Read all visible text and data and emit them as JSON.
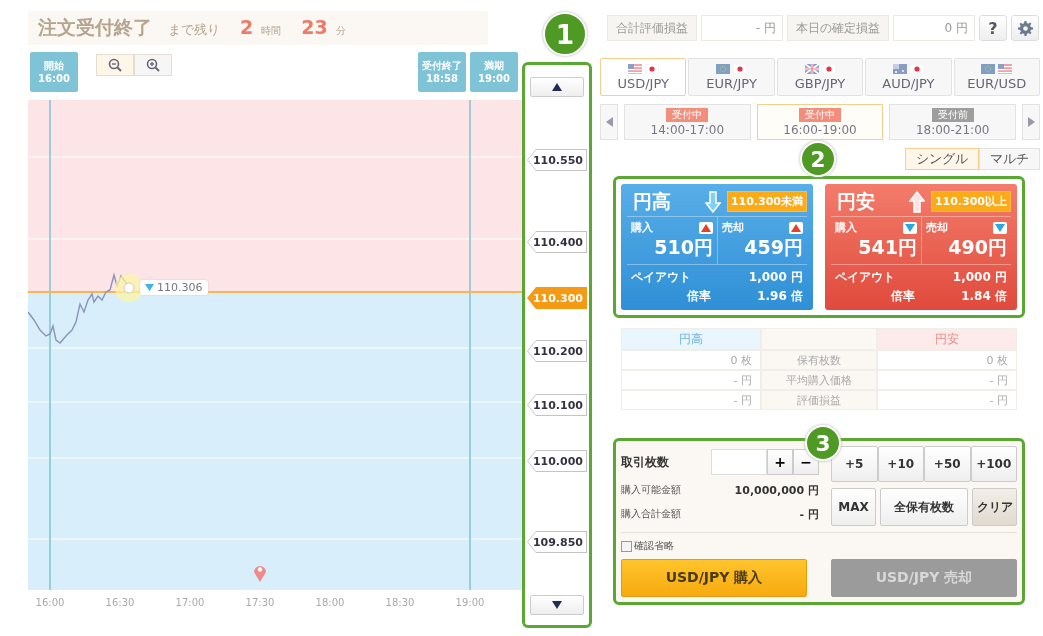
{
  "header": {
    "title": "注文受付終了",
    "remaining_label": "まで残り",
    "hours": "2",
    "hours_unit": "時間",
    "minutes": "23",
    "minutes_unit": "分",
    "summary": [
      {
        "label": "合計評価損益",
        "value": "- 円"
      },
      {
        "label": "本日の確定損益",
        "value": "0 円"
      }
    ],
    "help_button": "?"
  },
  "chart": {
    "markers": [
      {
        "label": "開始",
        "time": "16:00"
      },
      {
        "label": "受付終了",
        "time": "18:58"
      },
      {
        "label": "満期",
        "time": "19:00"
      }
    ],
    "current_price": "110.306",
    "x_labels": [
      "16:00",
      "16:30",
      "17:00",
      "17:30",
      "18:00",
      "18:30",
      "19:00"
    ]
  },
  "ladder": [
    {
      "label": "110.550",
      "selected": false
    },
    {
      "label": "110.400",
      "selected": false
    },
    {
      "label": "110.300",
      "selected": true
    },
    {
      "label": "110.200",
      "selected": false
    },
    {
      "label": "110.100",
      "selected": false
    },
    {
      "label": "110.000",
      "selected": false
    },
    {
      "label": "109.850",
      "selected": false
    }
  ],
  "currency_tabs": [
    {
      "label": "USD/JPY",
      "selected": true
    },
    {
      "label": "EUR/JPY",
      "selected": false
    },
    {
      "label": "GBP/JPY",
      "selected": false
    },
    {
      "label": "AUD/JPY",
      "selected": false
    },
    {
      "label": "EUR/USD",
      "selected": false
    }
  ],
  "sessions": [
    {
      "status": "受付中",
      "accepting": true,
      "time": "14:00-17:00",
      "selected": false
    },
    {
      "status": "受付中",
      "accepting": true,
      "time": "16:00-19:00",
      "selected": true
    },
    {
      "status": "受付前",
      "accepting": false,
      "time": "18:00-21:00",
      "selected": false
    }
  ],
  "modes": [
    {
      "label": "シングル",
      "selected": true
    },
    {
      "label": "マルチ",
      "selected": false
    }
  ],
  "options": [
    {
      "kind": "high",
      "title": "円高",
      "condition": "110.300未満",
      "buy_label": "購入",
      "buy_price": "510円",
      "buy_rising": true,
      "sell_label": "売却",
      "sell_price": "459円",
      "sell_rising": true,
      "payout_label": "ペイアウト",
      "payout": "1,000 円",
      "rate_label": "倍率",
      "rate": "1.96 倍"
    },
    {
      "kind": "low",
      "title": "円安",
      "condition": "110.300以上",
      "buy_label": "購入",
      "buy_price": "541円",
      "buy_rising": false,
      "sell_label": "売却",
      "sell_price": "490円",
      "sell_rising": false,
      "payout_label": "ペイアウト",
      "payout": "1,000 円",
      "rate_label": "倍率",
      "rate": "1.84 倍"
    }
  ],
  "positions": {
    "high_header": "円高",
    "low_header": "円安",
    "rows": [
      {
        "label": "保有枚数",
        "high": "0 枚",
        "low": "0 枚"
      },
      {
        "label": "平均購入価格",
        "high": "- 円",
        "low": "- 円"
      },
      {
        "label": "評価損益",
        "high": "- 円",
        "low": "- 円"
      }
    ]
  },
  "order": {
    "quantity_label": "取引枚数",
    "plus": "+",
    "minus": "−",
    "quick_adds": [
      "+5",
      "+10",
      "+50",
      "+100"
    ],
    "buttons": [
      "MAX",
      "全保有枚数",
      "クリア"
    ],
    "info": [
      {
        "label": "購入可能金額",
        "value": "10,000,000 円"
      },
      {
        "label": "購入合計金額",
        "value": "- 円"
      }
    ],
    "skip_confirm": {
      "label": "確認省略",
      "checked": false
    },
    "buy_button": {
      "label": "USD/JPY 購入",
      "disabled": false
    },
    "sell_button": {
      "label": "USD/JPY 売却",
      "disabled": true
    }
  },
  "callouts": [
    "1",
    "2",
    "3"
  ]
}
